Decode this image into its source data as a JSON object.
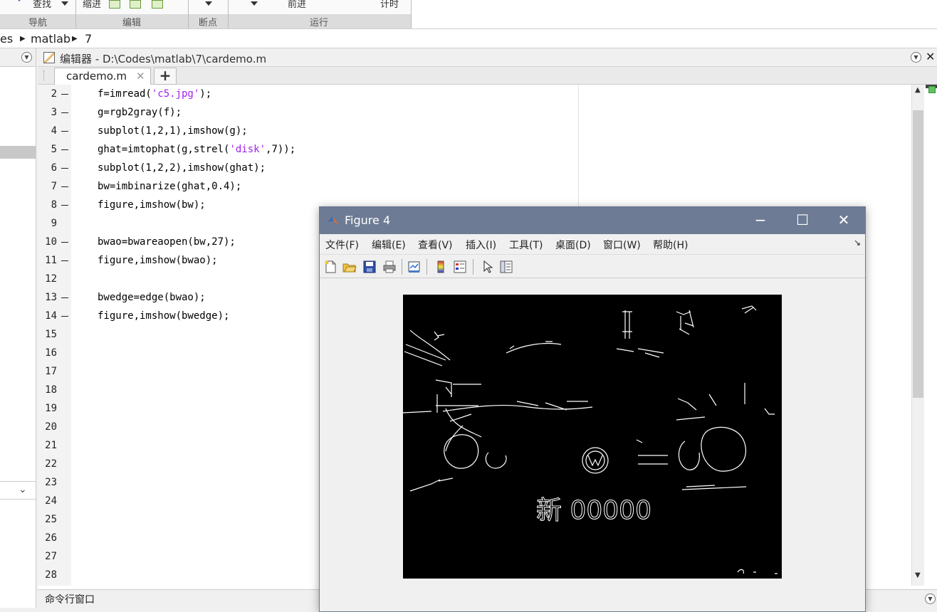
{
  "ribbon": {
    "tool_labels": [
      "查找",
      "缩进",
      "前进",
      "计时"
    ],
    "groups": [
      "导航",
      "编辑",
      "断点",
      "运行"
    ]
  },
  "breadcrumb": [
    "es",
    "matlab",
    "7"
  ],
  "editor": {
    "title": "编辑器 - D:\\Codes\\matlab\\7\\cardemo.m",
    "tab": "cardemo.m",
    "tab_close": "✕",
    "add_tab": "+",
    "line_numbers": [
      "2",
      "3",
      "4",
      "5",
      "6",
      "7",
      "8",
      "9",
      "10",
      "11",
      "12",
      "13",
      "14",
      "15",
      "16",
      "17",
      "18",
      "19",
      "20",
      "21",
      "22",
      "23",
      "24",
      "25",
      "26",
      "27",
      "28"
    ],
    "code_lines": [
      {
        "pre": "f=imread(",
        "str": "'c5.jpg'",
        "post": ");"
      },
      {
        "pre": "g=rgb2gray(f);",
        "str": "",
        "post": ""
      },
      {
        "pre": "subplot(1,2,1),imshow(g);",
        "str": "",
        "post": ""
      },
      {
        "pre": "ghat=imtophat(g,strel(",
        "str": "'disk'",
        "post": ",7));"
      },
      {
        "pre": "subplot(1,2,2),imshow(ghat);",
        "str": "",
        "post": ""
      },
      {
        "pre": "bw=imbinarize(ghat,0.4);",
        "str": "",
        "post": ""
      },
      {
        "pre": "figure,imshow(bw);",
        "str": "",
        "post": ""
      },
      {
        "pre": "",
        "str": "",
        "post": ""
      },
      {
        "pre": "bwao=bwareaopen(bw,27);",
        "str": "",
        "post": ""
      },
      {
        "pre": "figure,imshow(bwao);",
        "str": "",
        "post": ""
      },
      {
        "pre": "",
        "str": "",
        "post": ""
      },
      {
        "pre": "bwedge=edge(bwao);",
        "str": "",
        "post": ""
      },
      {
        "pre": "figure,imshow(bwedge);",
        "str": "",
        "post": ""
      }
    ]
  },
  "command_window": {
    "title": "命令行窗口"
  },
  "figure": {
    "title": "Figure 4",
    "menu": [
      "文件(F)",
      "编辑(E)",
      "查看(V)",
      "插入(I)",
      "工具(T)",
      "桌面(D)",
      "窗口(W)",
      "帮助(H)"
    ],
    "plate_text": "新 00000",
    "toolbar_icons": [
      "new-figure-icon",
      "open-file-icon",
      "save-icon",
      "print-icon",
      "link-plot-icon",
      "colorbar-icon",
      "legend-icon",
      "pointer-icon",
      "property-editor-icon"
    ]
  },
  "colors": {
    "string": "#a020f0",
    "figure_titlebar": "#6d7b94",
    "image_bg": "#000000"
  }
}
